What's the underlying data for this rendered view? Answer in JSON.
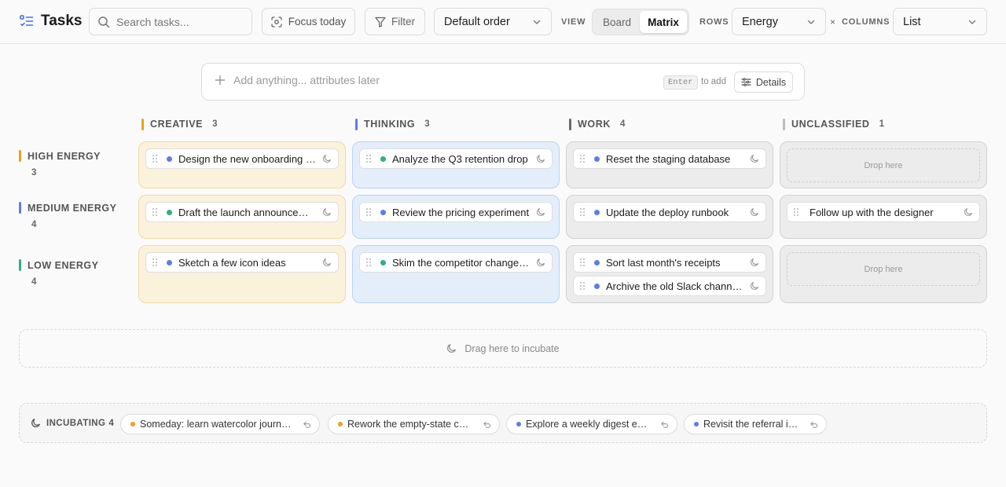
{
  "header": {
    "title": "Tasks",
    "search_placeholder": "Search tasks...",
    "focus_label": "Focus today",
    "filter_label": "Filter",
    "order_value": "Default order",
    "view_label": "VIEW",
    "view_options": [
      "Board",
      "Matrix"
    ],
    "view_selected": "Matrix",
    "rows_label": "ROWS",
    "rows_value": "Energy",
    "times_symbol": "×",
    "columns_label": "COLUMNS",
    "columns_value": "List"
  },
  "quick_add": {
    "placeholder": "Add anything... attributes later",
    "key_hint": "Enter",
    "key_hint_suffix": "to add",
    "details_label": "Details"
  },
  "columns": [
    {
      "name": "CREATIVE",
      "count": "3",
      "color": "#e8a219"
    },
    {
      "name": "THINKING",
      "count": "3",
      "color": "#5b7cf0"
    },
    {
      "name": "WORK",
      "count": "4",
      "color": "#6b6b6b"
    },
    {
      "name": "UNCLASSIFIED",
      "count": "1",
      "color": "#bdbdbd"
    }
  ],
  "rows": [
    {
      "name": "HIGH ENERGY",
      "count": "3",
      "color": "#e8a219"
    },
    {
      "name": "MEDIUM ENERGY",
      "count": "4",
      "color": "#5b7cf0"
    },
    {
      "name": "LOW ENERGY",
      "count": "4",
      "color": "#2fb07c"
    }
  ],
  "colors": {
    "dot_blue": "#5b7cf0",
    "dot_green": "#2fb07c",
    "dot_orange": "#f0a020"
  },
  "cells": {
    "high": {
      "creative": [
        {
          "text": "Design the new onboarding flow",
          "dot": "#5b7cf0"
        }
      ],
      "thinking": [
        {
          "text": "Analyze the Q3 retention drop",
          "dot": "#2fb07c"
        }
      ],
      "work": [
        {
          "text": "Reset the staging database",
          "dot": "#5b7cf0"
        }
      ],
      "unclassified_drop": "Drop here"
    },
    "medium": {
      "creative": [
        {
          "text": "Draft the launch announcement",
          "dot": "#2fb07c"
        }
      ],
      "thinking": [
        {
          "text": "Review the pricing experiment",
          "dot": "#5b7cf0"
        }
      ],
      "work": [
        {
          "text": "Update the deploy runbook",
          "dot": "#5b7cf0"
        }
      ],
      "unclassified": [
        {
          "text": "Follow up with the designer",
          "dot": ""
        }
      ]
    },
    "low": {
      "creative": [
        {
          "text": "Sketch a few icon ideas",
          "dot": "#5b7cf0"
        }
      ],
      "thinking": [
        {
          "text": "Skim the competitor changelog",
          "dot": "#2fb07c"
        }
      ],
      "work": [
        {
          "text": "Sort last month's receipts",
          "dot": "#5b7cf0"
        },
        {
          "text": "Archive the old Slack channels",
          "dot": "#5b7cf0"
        }
      ],
      "unclassified_drop": "Drop here"
    }
  },
  "incubate_zone": {
    "label": "Drag here to incubate"
  },
  "incubating": {
    "label": "INCUBATING",
    "count": "4",
    "items": [
      {
        "text": "Someday: learn watercolor journaling",
        "dot": "#f0a020"
      },
      {
        "text": "Rework the empty-state copy",
        "dot": "#f0a020"
      },
      {
        "text": "Explore a weekly digest email",
        "dot": "#5b7cf0"
      },
      {
        "text": "Revisit the referral idea",
        "dot": "#5b7cf0"
      }
    ]
  }
}
